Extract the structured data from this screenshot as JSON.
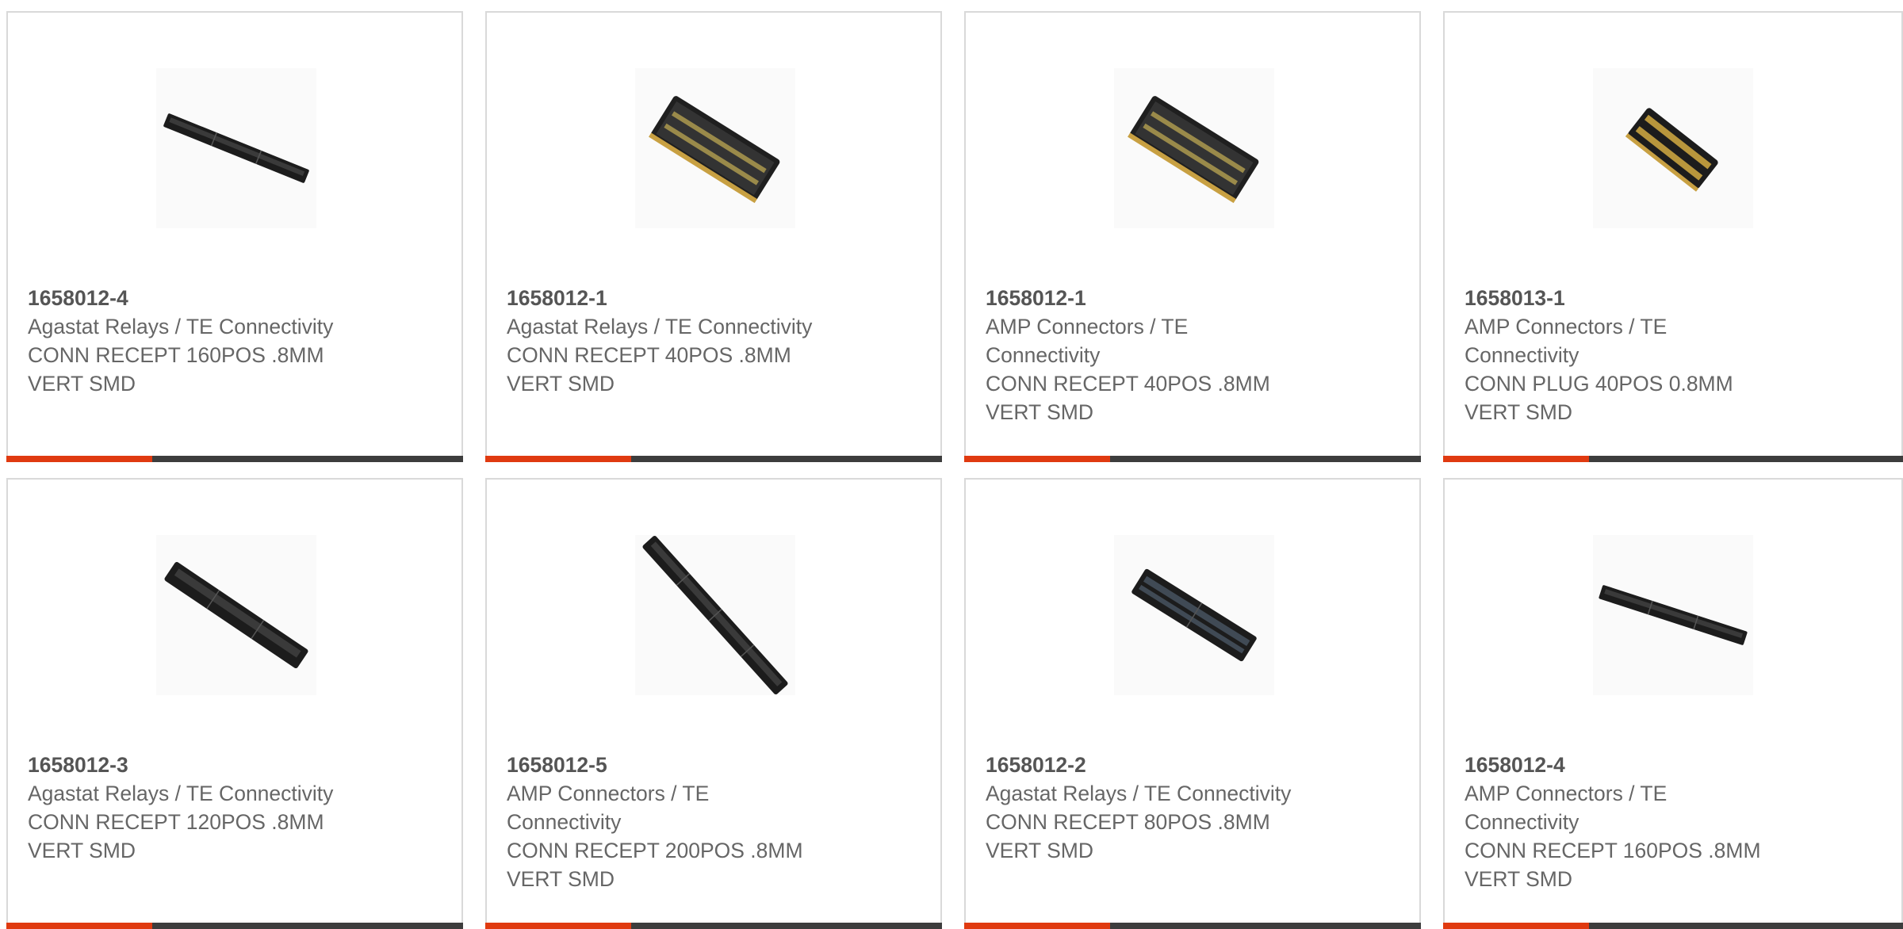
{
  "colors": {
    "accent": "#e03a10",
    "bar": "#3d3d3d",
    "text": "#666666",
    "border": "#d9d9d9"
  },
  "products": [
    {
      "part_number": "1658012-4",
      "lines": [
        "Agastat Relays / TE Connectivity",
        "CONN RECEPT 160POS .8MM",
        "VERT SMD"
      ],
      "image": "connector-long-thin-icon"
    },
    {
      "part_number": "1658012-1",
      "lines": [
        "Agastat Relays / TE Connectivity",
        "CONN RECEPT 40POS .8MM",
        "VERT SMD"
      ],
      "image": "connector-wide-icon"
    },
    {
      "part_number": "1658012-1",
      "lines": [
        "AMP Connectors / TE",
        "Connectivity",
        "CONN RECEPT 40POS .8MM",
        "VERT SMD"
      ],
      "image": "connector-wide-icon"
    },
    {
      "part_number": "1658013-1",
      "lines": [
        "AMP Connectors / TE",
        "Connectivity",
        "CONN PLUG 40POS 0.8MM",
        "VERT SMD"
      ],
      "image": "connector-plug-icon"
    },
    {
      "part_number": "1658012-3",
      "lines": [
        "Agastat Relays / TE Connectivity",
        "CONN RECEPT 120POS .8MM",
        "VERT SMD"
      ],
      "image": "connector-long-icon"
    },
    {
      "part_number": "1658012-5",
      "lines": [
        "AMP Connectors / TE",
        "Connectivity",
        "CONN RECEPT 200POS .8MM",
        "VERT SMD"
      ],
      "image": "connector-steep-icon"
    },
    {
      "part_number": "1658012-2",
      "lines": [
        "Agastat Relays / TE Connectivity",
        "CONN RECEPT 80POS .8MM",
        "VERT SMD"
      ],
      "image": "connector-medium-icon"
    },
    {
      "part_number": "1658012-4",
      "lines": [
        "AMP Connectors / TE",
        "Connectivity",
        "CONN RECEPT 160POS .8MM",
        "VERT SMD"
      ],
      "image": "connector-long-thin-icon"
    }
  ]
}
